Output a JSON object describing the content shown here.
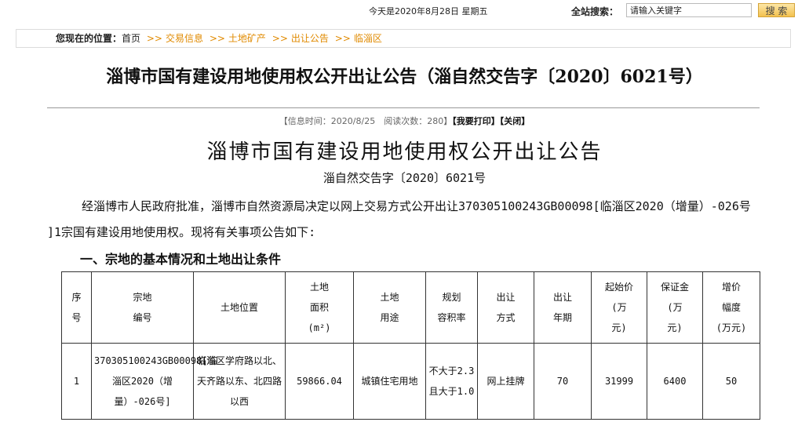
{
  "topbar": {
    "date": "今天是2020年8月28日 星期五",
    "search_label": "全站搜索：",
    "search_value": "请输入关键字",
    "search_button": "搜 索"
  },
  "breadcrumb": {
    "label": "您现在的位置：",
    "home": "首页",
    "separator": ">>",
    "items": [
      "交易信息",
      "土地矿产",
      "出让公告",
      "临淄区"
    ]
  },
  "page_title": "淄博市国有建设用地使用权公开出让公告（淄自然交告字〔2020〕6021号）",
  "meta": {
    "info": "【信息时间：2020/8/25　阅读次数：280】",
    "print": "【我要打印】",
    "close": "【关闭】"
  },
  "document": {
    "title": "淄博市国有建设用地使用权公开出让公告",
    "number": "淄自然交告字〔2020〕6021号",
    "paragraph": "经淄博市人民政府批准，淄博市自然资源局决定以网上交易方式公开出让370305100243GB00098[临淄区2020（增量）-026号 ]1宗国有建设用地使用权。现将有关事项公告如下:",
    "section_heading": "一、宗地的基本情况和土地出让条件"
  },
  "table": {
    "headers": [
      "序\n号",
      "宗地\n编号",
      "土地位置",
      "土地\n面积\n(m²)",
      "土地\n用途",
      "规划\n容积率",
      "出让\n方式",
      "出让\n年期",
      "起始价\n(万\n元)",
      "保证金\n(万\n元)",
      "增价\n幅度\n(万元)"
    ],
    "rows": [
      [
        "1",
        "370305100243GB00098[临淄区2020（增量）-026号]",
        "临淄区学府路以北、天齐路以东、北四路以西",
        "59866.04",
        "城镇住宅用地",
        "不大于2.3且大于1.0",
        "网上挂牌",
        "70",
        "31999",
        "6400",
        "50"
      ]
    ]
  }
}
